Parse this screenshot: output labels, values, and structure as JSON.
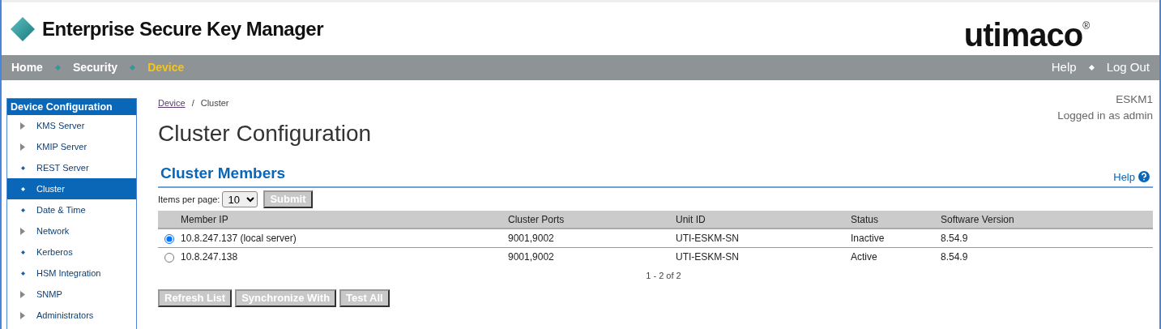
{
  "header": {
    "title": "Enterprise Secure Key Manager",
    "brand": "utimaco",
    "brand_mark": "®"
  },
  "topnav": {
    "left": [
      {
        "label": "Home",
        "selected": false
      },
      {
        "label": "Security",
        "selected": false
      },
      {
        "label": "Device",
        "selected": true
      }
    ],
    "right": [
      {
        "label": "Help"
      },
      {
        "label": "Log Out"
      }
    ]
  },
  "sidebar": {
    "title": "Device Configuration",
    "items": [
      {
        "label": "KMS Server",
        "kind": "section",
        "selected": false
      },
      {
        "label": "KMIP Server",
        "kind": "section",
        "selected": false
      },
      {
        "label": "REST Server",
        "kind": "page",
        "selected": false
      },
      {
        "label": "Cluster",
        "kind": "page",
        "selected": true
      },
      {
        "label": "Date & Time",
        "kind": "page",
        "selected": false
      },
      {
        "label": "Network",
        "kind": "section",
        "selected": false
      },
      {
        "label": "Kerberos",
        "kind": "page",
        "selected": false
      },
      {
        "label": "HSM Integration",
        "kind": "page",
        "selected": false
      },
      {
        "label": "SNMP",
        "kind": "section",
        "selected": false
      },
      {
        "label": "Administrators",
        "kind": "section",
        "selected": false
      }
    ]
  },
  "breadcrumb": [
    {
      "label": "Device",
      "kind": "link"
    },
    {
      "label": "/",
      "kind": "separator"
    },
    {
      "label": "Cluster",
      "kind": "current"
    }
  ],
  "user": {
    "host": "ESKM1",
    "login": "Logged in as admin"
  },
  "page_title": "Cluster Configuration",
  "section": {
    "title": "Cluster Members",
    "help": "Help"
  },
  "pager": {
    "label": "Items per page:",
    "value": "10",
    "submit": {
      "label": "Submit",
      "disabled": true
    }
  },
  "table": {
    "columns": [
      "Member IP",
      "Cluster Ports",
      "Unit ID",
      "Status",
      "Software Version"
    ],
    "rows": [
      {
        "selected": true,
        "cells": [
          "10.8.247.137 (local server)",
          "9001,9002",
          "UTI-ESKM-SN",
          "Inactive",
          "8.54.9"
        ]
      },
      {
        "selected": false,
        "cells": [
          "10.8.247.138",
          "9001,9002",
          "UTI-ESKM-SN",
          "Active",
          "8.54.9"
        ]
      }
    ]
  },
  "count": "1 - 2 of 2",
  "buttons": [
    {
      "label": "Refresh List",
      "disabled": true
    },
    {
      "label": "Synchronize With",
      "disabled": true
    },
    {
      "label": "Test All",
      "disabled": true
    }
  ]
}
